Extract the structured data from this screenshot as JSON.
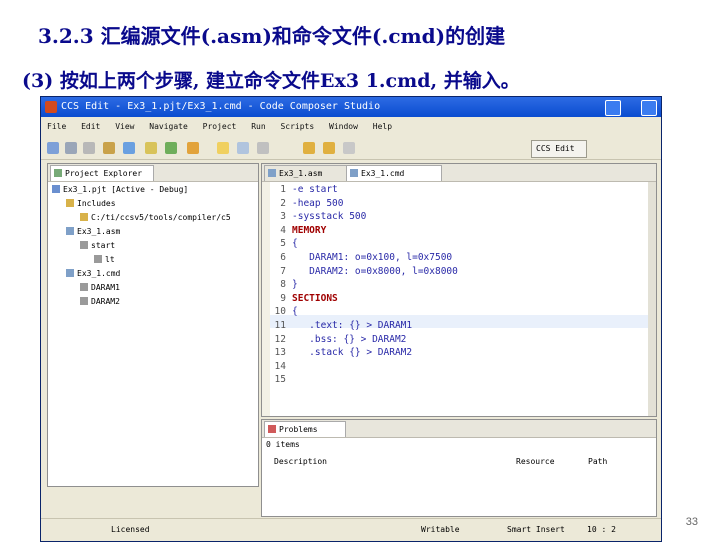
{
  "slide": {
    "title": "3.2.3 汇编源文件(.asm)和命令文件(.cmd)的创建",
    "subtitle": "(3)  按如上两个步骤, 建立命令文件Ex3  1.cmd, 并输入。",
    "page_number": "33"
  },
  "window": {
    "title": "CCS Edit - Ex3_1.pjt/Ex3_1.cmd - Code Composer Studio",
    "menu": [
      "File",
      "Edit",
      "View",
      "Navigate",
      "Project",
      "Run",
      "Scripts",
      "Window",
      "Help"
    ],
    "perspective": "CCS Edit"
  },
  "project_explorer": {
    "tab_label": "Project Explorer",
    "tree": [
      {
        "label": "Ex3_1.pjt  [Active - Debug]",
        "depth": 0
      },
      {
        "label": "Includes",
        "depth": 1
      },
      {
        "label": "C:/ti/ccsv5/tools/compiler/c5",
        "depth": 2
      },
      {
        "label": "Ex3_1.asm",
        "depth": 1
      },
      {
        "label": "start",
        "depth": 2
      },
      {
        "label": "lt",
        "depth": 3
      },
      {
        "label": "Ex3_1.cmd",
        "depth": 1
      },
      {
        "label": "DARAM1",
        "depth": 2
      },
      {
        "label": "DARAM2",
        "depth": 2
      }
    ]
  },
  "editor": {
    "tabs": [
      "Ex3_1.asm",
      "Ex3_1.cmd"
    ],
    "active_tab": 1,
    "current_line": 10,
    "lines": [
      {
        "n": "1",
        "text": "-e start",
        "kw": false
      },
      {
        "n": "2",
        "text": "-heap 500",
        "kw": false
      },
      {
        "n": "3",
        "text": "-sysstack 500",
        "kw": false
      },
      {
        "n": "4",
        "text": "MEMORY",
        "kw": true
      },
      {
        "n": "5",
        "text": "{",
        "kw": false
      },
      {
        "n": "6",
        "text": "   DARAM1: o=0x100, l=0x7500",
        "kw": false
      },
      {
        "n": "7",
        "text": "   DARAM2: o=0x8000, l=0x8000",
        "kw": false
      },
      {
        "n": "8",
        "text": "}",
        "kw": false
      },
      {
        "n": "9",
        "text": "SECTIONS",
        "kw": true
      },
      {
        "n": "10",
        "text": "{",
        "kw": false
      },
      {
        "n": "11",
        "text": "   .text: {} > DARAM1",
        "kw": false
      },
      {
        "n": "12",
        "text": "   .bss: {} > DARAM2",
        "kw": false
      },
      {
        "n": "13",
        "text": "   .stack {} > DARAM2",
        "kw": false
      },
      {
        "n": "14",
        "text": "",
        "kw": false
      },
      {
        "n": "15",
        "text": "",
        "kw": false
      }
    ]
  },
  "problems": {
    "tab_label": "Problems",
    "summary": "0 items",
    "columns": [
      "Description",
      "Resource",
      "Path"
    ]
  },
  "status": {
    "license": "Licensed",
    "mode": "Writable",
    "insert": "Smart Insert",
    "position": "10 : 2"
  }
}
